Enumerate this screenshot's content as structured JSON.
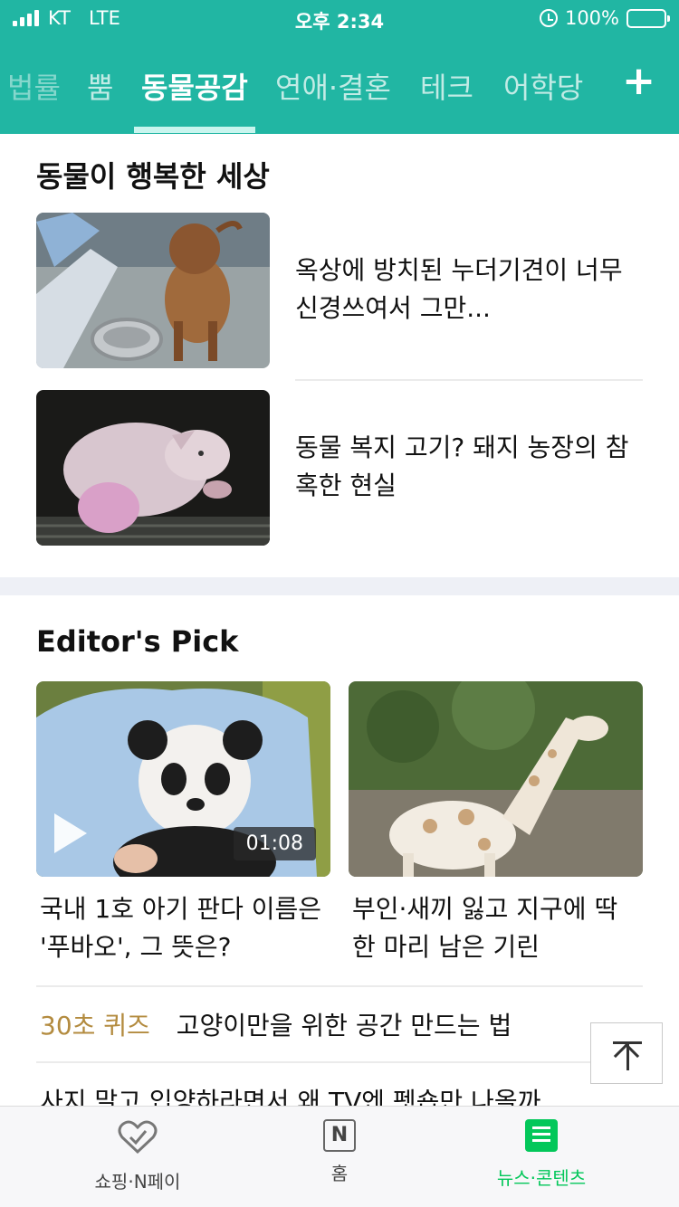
{
  "status_bar": {
    "carrier": "KT",
    "network": "LTE",
    "time": "오후 2:34",
    "battery": "100%"
  },
  "tabs": [
    {
      "label": "법률"
    },
    {
      "label": "뿜"
    },
    {
      "label": "동물공감"
    },
    {
      "label": "연애·결혼"
    },
    {
      "label": "테크"
    },
    {
      "label": "어학당"
    }
  ],
  "section1": {
    "title": "동물이 행복한 세상",
    "items": [
      {
        "title": "옥상에 방치된 누더기견이 너무 신경쓰여서 그만..."
      },
      {
        "title": "동물 복지 고기? 돼지 농장의 참혹한 현실"
      }
    ]
  },
  "section2": {
    "title": "Editor's Pick",
    "cards": [
      {
        "title": "국내 1호 아기 판다 이름은 '푸바오', 그 뜻은?",
        "duration": "01:08"
      },
      {
        "title": "부인·새끼 잃고 지구에 딱 한 마리 남은 기린"
      }
    ],
    "quiz": {
      "tag": "30초 퀴즈",
      "title": "고양이만을 위한 공간 만드는 법"
    },
    "next_item": "사지 말고 입양하라면서 왜 TV엔 펫숍만 나올까"
  },
  "bottom_nav": [
    {
      "label": "쇼핑·N페이",
      "icon": "heart-check-icon"
    },
    {
      "label": "홈",
      "icon": "naver-n-icon"
    },
    {
      "label": "뉴스·콘텐츠",
      "icon": "news-icon"
    }
  ],
  "colors": {
    "header": "#21b6a3",
    "active_nav": "#03c75a",
    "quiz_tag": "#b38b3f"
  }
}
